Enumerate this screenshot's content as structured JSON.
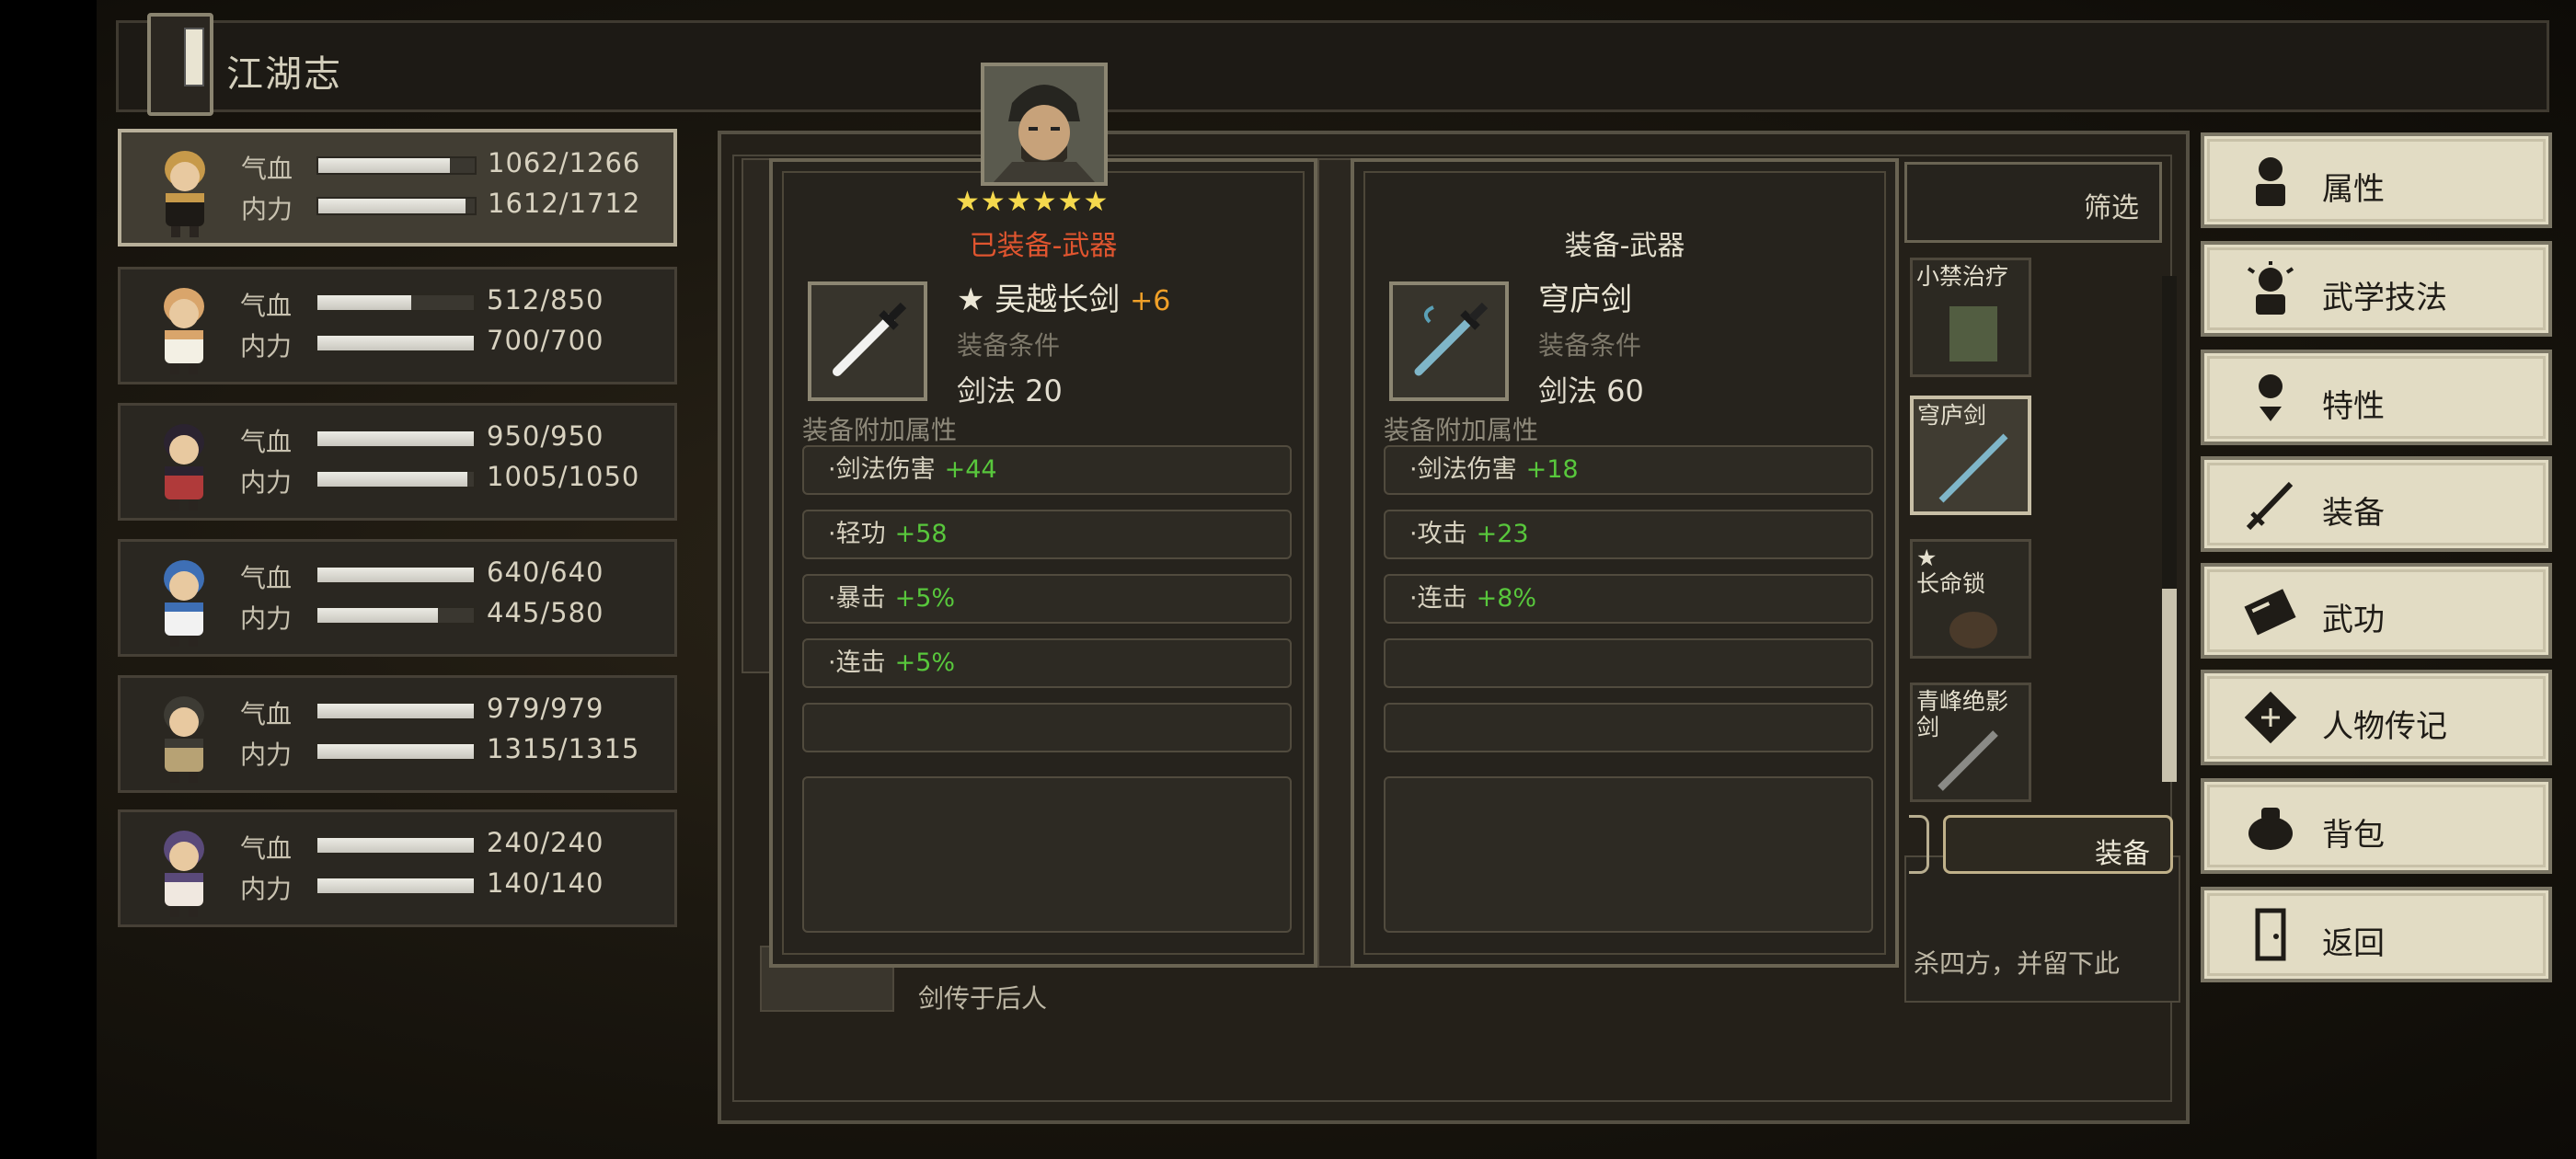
{
  "header": {
    "title": "江湖志"
  },
  "party": [
    {
      "hp_label": "气血",
      "hp": "1062/1266",
      "hp_frac": 0.84,
      "mp_label": "内力",
      "mp": "1612/1712",
      "mp_frac": 0.94
    },
    {
      "hp_label": "气血",
      "hp": "512/850",
      "hp_frac": 0.6,
      "mp_label": "内力",
      "mp": "700/700",
      "mp_frac": 1.0
    },
    {
      "hp_label": "气血",
      "hp": "950/950",
      "hp_frac": 1.0,
      "mp_label": "内力",
      "mp": "1005/1050",
      "mp_frac": 0.96
    },
    {
      "hp_label": "气血",
      "hp": "640/640",
      "hp_frac": 1.0,
      "mp_label": "内力",
      "mp": "445/580",
      "mp_frac": 0.77
    },
    {
      "hp_label": "气血",
      "hp": "979/979",
      "hp_frac": 1.0,
      "mp_label": "内力",
      "mp": "1315/1315",
      "mp_frac": 1.0
    },
    {
      "hp_label": "气血",
      "hp": "240/240",
      "hp_frac": 1.0,
      "mp_label": "内力",
      "mp": "140/140",
      "mp_frac": 1.0
    }
  ],
  "equipped": {
    "stars": "★★★★★★",
    "header": "已装备-武器",
    "name": "★ 吴越长剑",
    "plus": "+6",
    "cond_label": "装备条件",
    "req": "剑法  20",
    "bonus_title": "装备附加属性",
    "bonuses": [
      {
        "label": "·剑法伤害",
        "value": "+44"
      },
      {
        "label": "·轻功",
        "value": "+58"
      },
      {
        "label": "·暴击",
        "value": "+5%"
      },
      {
        "label": "·连击",
        "value": "+5%"
      }
    ]
  },
  "candidate": {
    "header": "装备-武器",
    "name": "穹庐剑",
    "cond_label": "装备条件",
    "req": "剑法  60",
    "bonus_title": "装备附加属性",
    "bonuses": [
      {
        "label": "·剑法伤害",
        "value": "+18"
      },
      {
        "label": "·攻击",
        "value": "+23"
      },
      {
        "label": "·连击",
        "value": "+8%"
      }
    ]
  },
  "filter": {
    "label": "筛选"
  },
  "items": [
    {
      "name": "小禁治疗"
    },
    {
      "name": "穹庐剑"
    },
    {
      "name": "★\n长命锁"
    },
    {
      "name": "青峰绝影\n剑"
    }
  ],
  "equip_button": {
    "label": "装备"
  },
  "desc_fragments": {
    "line_right": "杀四方，并留下此",
    "line_left": "剑传于后人"
  },
  "menu": [
    {
      "label": "属性",
      "icon": "person-icon"
    },
    {
      "label": "武学技法",
      "icon": "skill-person-icon"
    },
    {
      "label": "特性",
      "icon": "trait-person-icon"
    },
    {
      "label": "装备",
      "icon": "sword-icon"
    },
    {
      "label": "武功",
      "icon": "book-icon"
    },
    {
      "label": "人物传记",
      "icon": "scroll-icon"
    },
    {
      "label": "背包",
      "icon": "bag-icon"
    },
    {
      "label": "返回",
      "icon": "door-icon"
    }
  ],
  "colors": {
    "equipped_header": "#e0552f",
    "plus": "#f0a028",
    "bonus_green": "#58c73c",
    "stars": "#f5d94d"
  }
}
